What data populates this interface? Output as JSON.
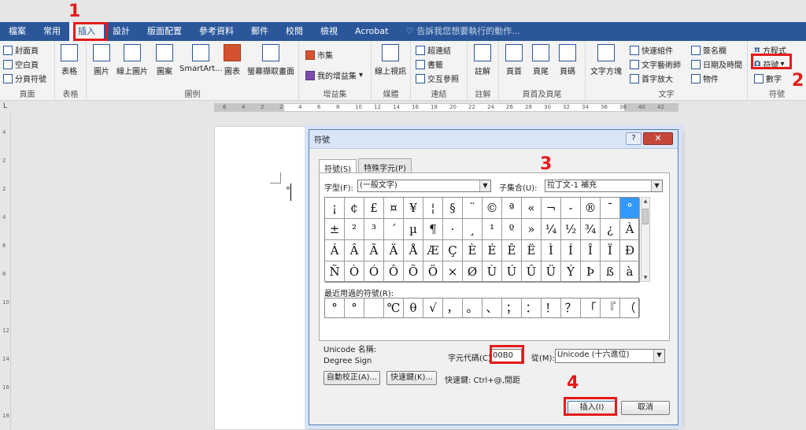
{
  "tabs": [
    "檔案",
    "常用",
    "插入",
    "設計",
    "版面配置",
    "參考資料",
    "郵件",
    "校閱",
    "檢視",
    "Acrobat"
  ],
  "tell_me": "告訴我您想要執行的動作...",
  "ribbon": {
    "pages": {
      "items": [
        "封面頁",
        "空白頁",
        "分頁符號"
      ],
      "label": "頁面"
    },
    "tables": {
      "button": "表格",
      "label": "表格"
    },
    "illustrations": {
      "buttons": [
        "圖片",
        "線上圖片",
        "圖案",
        "SmartArt...",
        "圖表",
        "螢幕擷取畫面"
      ],
      "label": "圖例"
    },
    "addins": {
      "store": "市集",
      "my_addins": "我的增益集",
      "label": "增益集"
    },
    "media": {
      "button": "線上視訊",
      "label": "媒體"
    },
    "links": {
      "items": [
        "超連結",
        "書籤",
        "交互參照"
      ],
      "label": "連結"
    },
    "comments": {
      "button": "註解",
      "label": "註解"
    },
    "header_footer": {
      "buttons": [
        "頁首",
        "頁尾",
        "頁碼"
      ],
      "label": "頁首及頁尾"
    },
    "text": {
      "textbox": "文字方塊",
      "items": [
        "快速組件",
        "文字藝術師",
        "首字放大"
      ],
      "items2": [
        "簽名欄",
        "日期及時間",
        "物件"
      ],
      "label": "文字"
    },
    "symbols": {
      "equation": "方程式",
      "symbol": "符號",
      "number": "數字",
      "label": "符號"
    }
  },
  "ruler": {
    "numbers": [
      "6",
      "4",
      "2",
      "2",
      "4",
      "6",
      "8",
      "10",
      "12",
      "14",
      "16",
      "18",
      "20",
      "22",
      "24",
      "26",
      "28",
      "30",
      "32",
      "34",
      "36",
      "38",
      "40",
      "42"
    ]
  },
  "vruler": {
    "numbers": [
      "4",
      "2",
      "2",
      "4",
      "6",
      "8",
      "10",
      "12",
      "14",
      "16",
      "18"
    ]
  },
  "corner": "L",
  "document": {
    "char": "°"
  },
  "dialog": {
    "title": "符號",
    "help": "?",
    "close": "✕",
    "tab_symbols": "符號(S)",
    "tab_special": "特殊字元(P)",
    "font_label": "字型(F):",
    "font_value": "(一般文字)",
    "subset_label": "子集合(U):",
    "subset_value": "拉丁文-1 補充",
    "grid": [
      [
        "¡",
        "¢",
        "£",
        "¤",
        "¥",
        "¦",
        "§",
        "¨",
        "©",
        "ª",
        "«",
        "¬",
        "-",
        "®",
        "¯",
        "°"
      ],
      [
        "±",
        "²",
        "³",
        "´",
        "µ",
        "¶",
        "·",
        "¸",
        "¹",
        "º",
        "»",
        "¼",
        "½",
        "¾",
        "¿",
        "À"
      ],
      [
        "Á",
        "Â",
        "Ã",
        "Ä",
        "Å",
        "Æ",
        "Ç",
        "È",
        "É",
        "Ê",
        "Ë",
        "Ì",
        "Í",
        "Î",
        "Ï",
        "Ð"
      ],
      [
        "Ñ",
        "Ò",
        "Ó",
        "Ô",
        "Õ",
        "Ö",
        "×",
        "Ø",
        "Ù",
        "Ú",
        "Û",
        "Ü",
        "Ý",
        "Þ",
        "ß",
        "à"
      ]
    ],
    "recent_label": "最近用過的符號(R):",
    "recent": [
      "°",
      "°",
      "",
      "℃",
      "θ",
      "√",
      "，",
      "。",
      "、",
      "；",
      "：",
      "！",
      "？",
      "「",
      "『",
      "（"
    ],
    "unicode_name_label": "Unicode 名稱:",
    "unicode_name": "Degree Sign",
    "code_label": "字元代碼(C):",
    "code_value": "00B0",
    "from_label": "從(M):",
    "from_value": "Unicode (十六進位)",
    "autocorrect": "自動校正(A)...",
    "shortcut_key": "快速鍵(K)...",
    "shortcut_text": "快速鍵: Ctrl+@,閒距",
    "insert": "插入(I)",
    "cancel": "取消"
  },
  "annotations": [
    "1",
    "2",
    "3",
    "4"
  ],
  "colors": {
    "accent": "#2b579a",
    "annotation": "#e51b1b",
    "selected": "#3399ff"
  }
}
